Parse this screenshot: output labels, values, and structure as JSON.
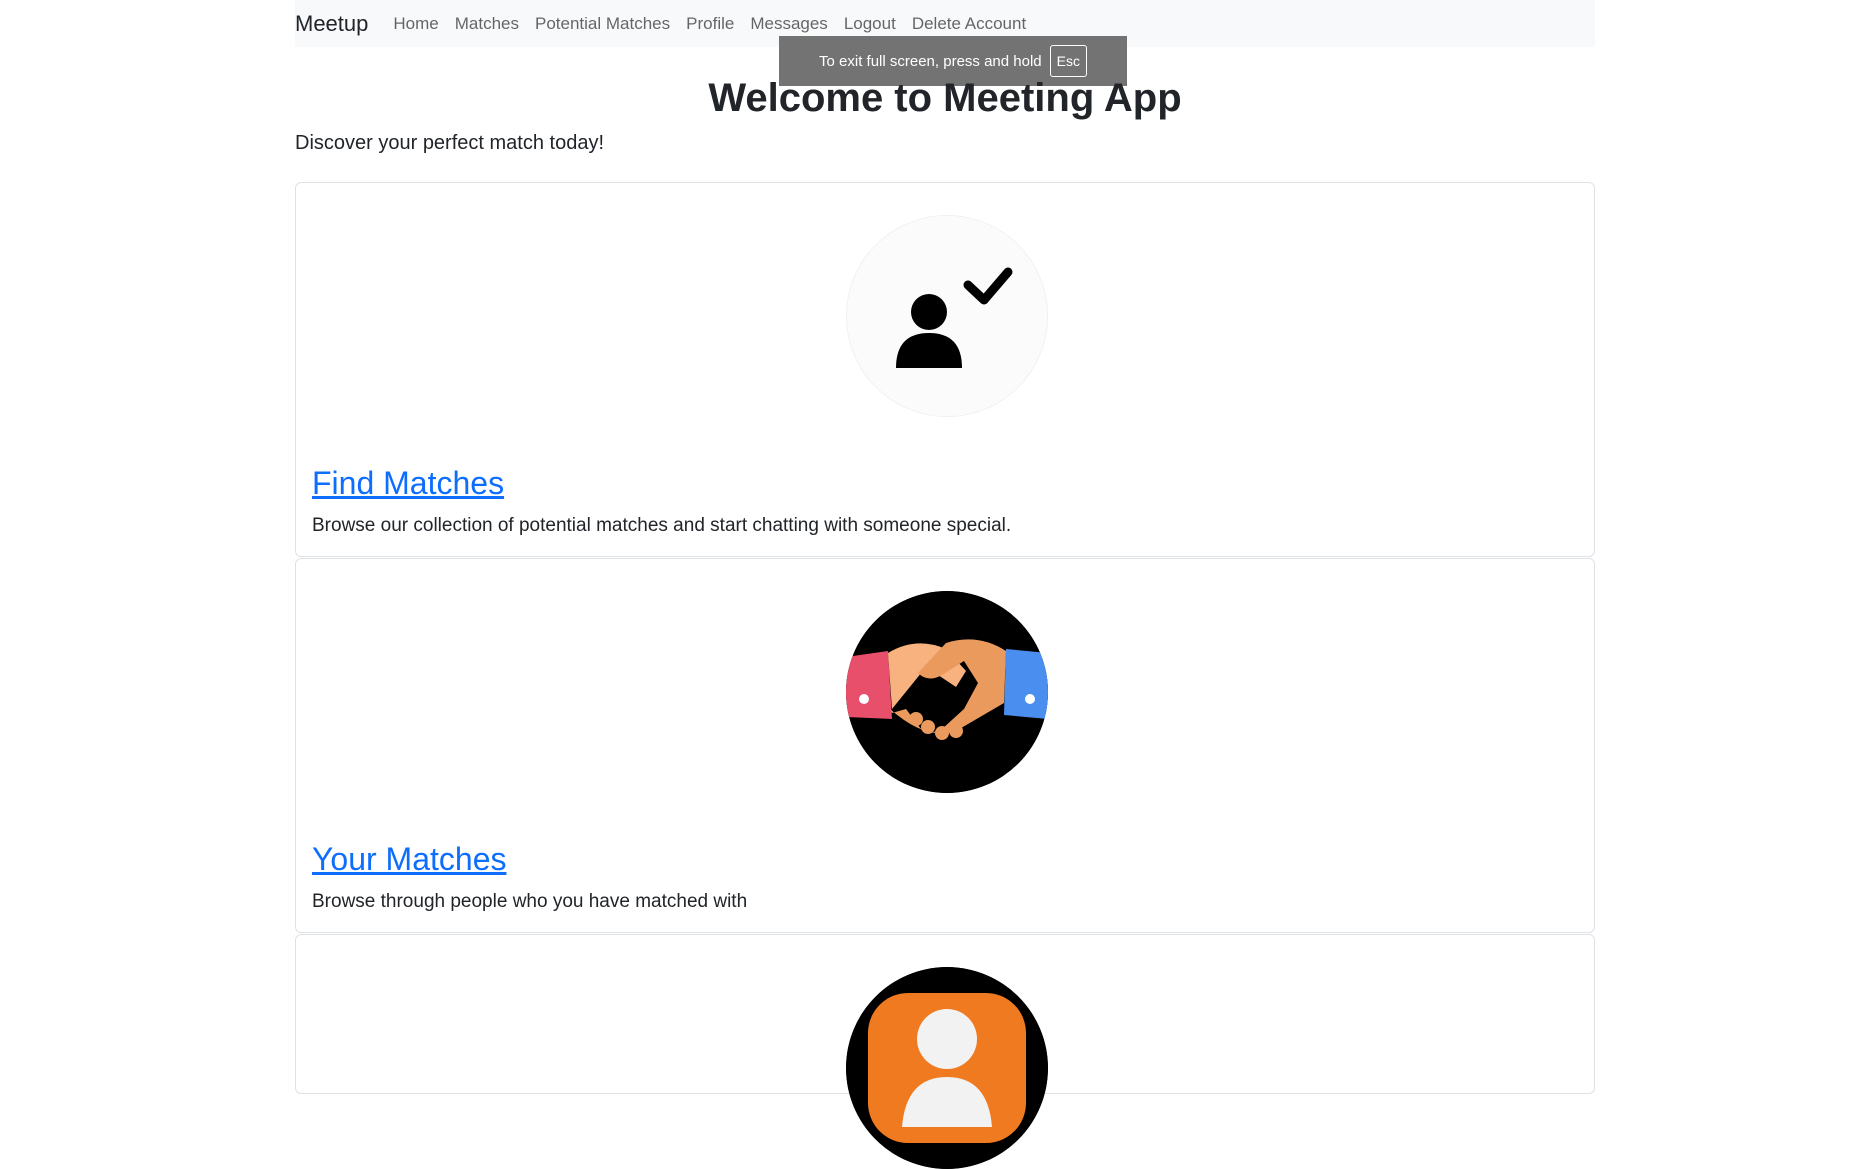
{
  "navbar": {
    "brand": "Meetup",
    "links": [
      "Home",
      "Matches",
      "Potential Matches",
      "Profile",
      "Messages",
      "Logout",
      "Delete Account"
    ]
  },
  "fullscreen_toast": {
    "message": "To exit full screen, press and hold",
    "key": "Esc"
  },
  "main": {
    "title": "Welcome to Meeting App",
    "lead": "Discover your perfect match today!",
    "cards": [
      {
        "title": "Find Matches",
        "text": "Browse our collection of potential matches and start chatting with someone special.",
        "icon": "user-check-icon"
      },
      {
        "title": "Your Matches",
        "text": "Browse through people who you have matched with",
        "icon": "handshake-icon"
      },
      {
        "title": "",
        "text": "",
        "icon": "profile-icon"
      }
    ]
  },
  "colors": {
    "link": "#0d6efd",
    "navbar_bg": "#f8f9fa",
    "toast_bg": "#737373",
    "orange": "#f07a1f"
  }
}
